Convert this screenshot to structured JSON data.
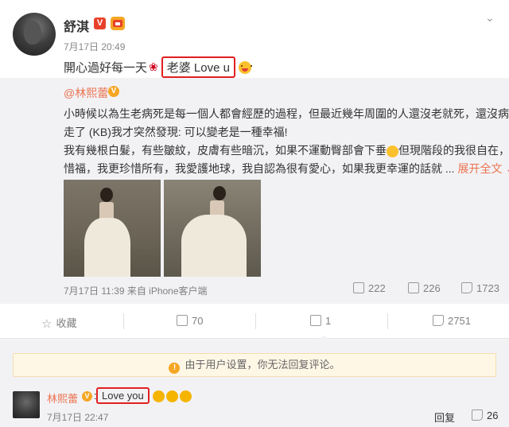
{
  "post": {
    "username": "舒淇",
    "verified_badge": "V",
    "time": "7月17日 20:49",
    "text_before": "開心過好每一天",
    "rose_icon": "rose-icon",
    "highlight_text": "老婆 Love u",
    "emoji_icon": "grin-emoji-icon"
  },
  "repost": {
    "author": "@林熙蕾",
    "lines": [
      "小時候以為生老病死是每一個人都會經歷的過程，但最近幾年周圍的人還沒老就死，還沒病就",
      "走了 (KB)我才突然發現: 可以變老是一種幸福!",
      "我有幾根白髮，有些皺紋，皮膚有些暗沉，如果不運動臀部會下垂",
      "但現階段的我很自在，很",
      "惜福，我更珍惜所有，我愛護地球，我自認為很有愛心，如果我更幸運的話就 ...",
      "展开全文"
    ],
    "source": "7月17日 11:39 来自 iPhone客户端",
    "reposts": "222",
    "comments": "226",
    "likes": "1723"
  },
  "actions": {
    "favorite": "收藏",
    "repost": "70",
    "comment": "1",
    "like": "2751"
  },
  "comments": {
    "notice": "由于用户设置，你无法回复评论。",
    "items": [
      {
        "name": "林熙蕾",
        "colon": ":",
        "text": "Love you",
        "time": "7月17日 22:47",
        "reply": "回复",
        "likes": "26"
      }
    ]
  }
}
